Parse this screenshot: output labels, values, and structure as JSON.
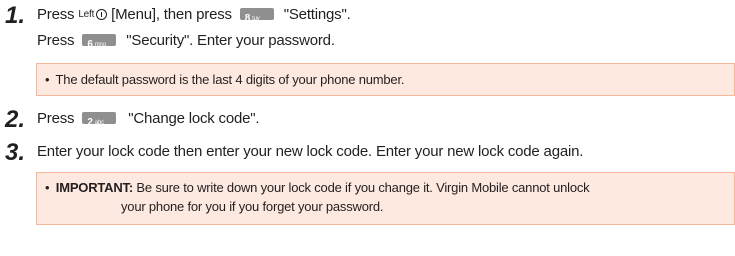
{
  "steps": [
    {
      "number": "1.",
      "line1": {
        "press": "Press",
        "softkey_label": "Left",
        "menu": "[Menu], then press",
        "key": {
          "digit": "8",
          "letters": "tuv"
        },
        "target": "\"Settings\"."
      },
      "line2": {
        "press": "Press",
        "key": {
          "digit": "6",
          "letters": "mno"
        },
        "target": "\"Security\".  Enter your password."
      },
      "note": {
        "bullet": "•",
        "text": "The default password is the last 4 digits of your phone number."
      }
    },
    {
      "number": "2.",
      "press": "Press",
      "key": {
        "digit": "2",
        "letters": "abc"
      },
      "target": "\"Change lock code\"."
    },
    {
      "number": "3.",
      "text": "Enter your lock code then enter your new lock code.  Enter your new lock code again.",
      "note": {
        "bullet": "•",
        "label": "IMPORTANT:",
        "line1": "Be sure to write down your lock code if you change it. Virgin Mobile cannot unlock",
        "line2": "your phone for you if you forget your password."
      }
    }
  ]
}
